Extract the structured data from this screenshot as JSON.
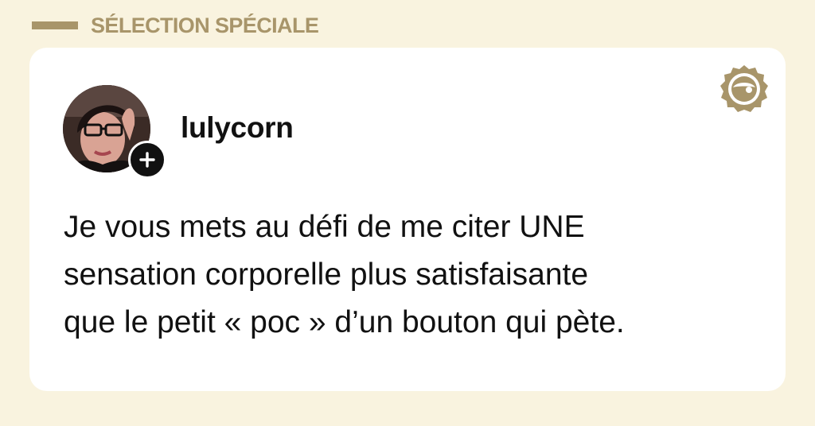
{
  "section": {
    "title": "SÉLECTION SPÉCIALE",
    "accent_color": "#a8956a"
  },
  "post": {
    "username": "lulycorn",
    "avatar_icon": "user-avatar-photo",
    "follow_icon": "plus-icon",
    "brand_icon": "brand-face-seal-icon",
    "text_lines": [
      "Je vous mets au défi de me citer UNE",
      "sensation corporelle plus satisfaisante",
      "que le petit « poc » d’un bouton qui pète."
    ]
  },
  "colors": {
    "background": "#f9f3df",
    "card": "#ffffff",
    "text": "#111111"
  }
}
